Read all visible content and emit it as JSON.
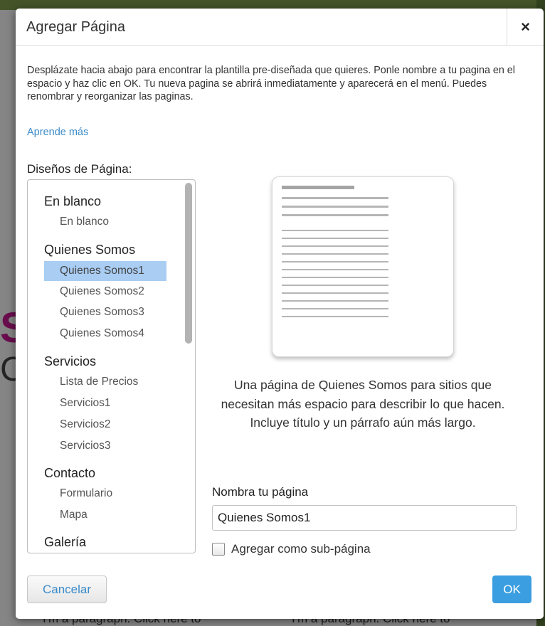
{
  "dialog": {
    "title": "Agregar Página",
    "close_symbol": "×",
    "instructions": "Desplázate hacia abajo para encontrar la plantilla pre-diseñada que quieres. Ponle nombre a tu pagina en el espacio y haz clic en OK. Tu nueva pagina se abrirá inmediatamente y aparecerá en el menú. Puedes renombrar y reorganizar las paginas.",
    "learn_more": "Aprende más",
    "layouts_label": "Diseños de Página:",
    "groups": [
      {
        "title": "En blanco",
        "items": [
          "En blanco"
        ]
      },
      {
        "title": "Quienes Somos",
        "items": [
          "Quienes Somos1",
          "Quienes Somos2",
          "Quienes Somos3",
          "Quienes Somos4"
        ]
      },
      {
        "title": "Servicios",
        "items": [
          "Lista de Precios",
          "Servicios1",
          "Servicios2",
          "Servicios3"
        ]
      },
      {
        "title": "Contacto",
        "items": [
          "Formulario",
          "Mapa"
        ]
      },
      {
        "title": "Galería",
        "items": []
      }
    ],
    "selected_item": "Quienes Somos1",
    "preview_description": "Una página de Quienes Somos para sitios que necesitan más espacio para describir lo que hacen. Incluye título y un párrafo aún más largo.",
    "name_label": "Nombra tu página",
    "name_value": "Quienes Somos1",
    "subpage_label": "Agregar como sub-página",
    "subpage_checked": false,
    "cancel_label": "Cancelar",
    "ok_label": "OK"
  },
  "background": {
    "text_left": "I'm a paragraph. Click here to",
    "text_right": "I'm a paragraph. Click here to"
  },
  "colors": {
    "accent": "#3a9ee0",
    "link": "#3b8bc9",
    "selection": "#a9cdf3"
  }
}
